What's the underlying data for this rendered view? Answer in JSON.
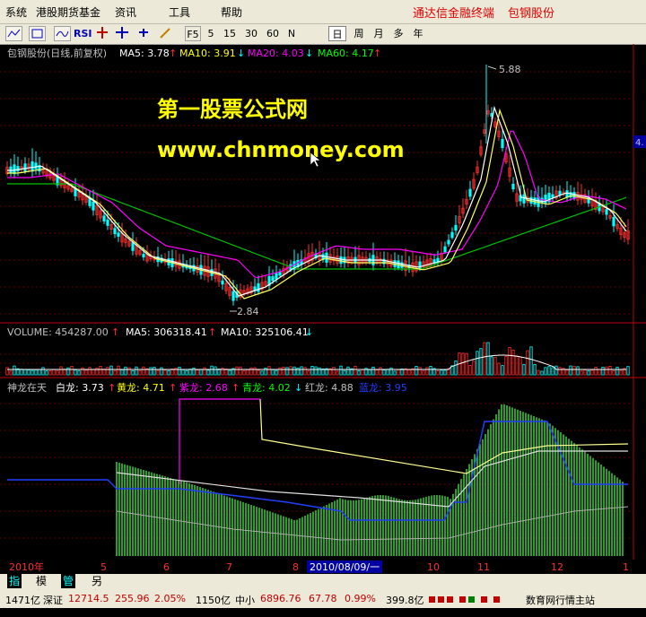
{
  "menu": {
    "items": [
      "系统",
      "港股期货基金",
      "资讯",
      "工具",
      "帮助"
    ],
    "brand": "通达信金融终端",
    "stock": "包钢股份"
  },
  "toolbar": {
    "buttons": [
      "RSI",
      "F5",
      "5",
      "15",
      "30",
      "60",
      "N",
      "日",
      "周",
      "月",
      "多",
      "年"
    ]
  },
  "price_panel": {
    "title": "包钢股份(日线,前复权)",
    "ma5": "MA5: 3.78",
    "ma10": "MA10: 3.91",
    "ma20": "MA20: 4.03",
    "ma60": "MA60: 4.17",
    "high_label": "5.88",
    "low_label": "2.84",
    "right_label": "4.",
    "watermark_cn": "第一股票公式网",
    "watermark_url": "www.chnmoney.com"
  },
  "volume_panel": {
    "vol": "VOLUME: 454287.00",
    "ma5": "MA5: 306318.41",
    "ma10": "MA10: 325106.41"
  },
  "indicator_panel": {
    "name": "神龙在天",
    "bai": "白龙: 3.73",
    "huang": "黄龙: 4.71",
    "zi": "紫龙: 2.68",
    "qing": "青龙: 4.02",
    "hong": "红龙: 4.88",
    "lan": "蓝龙: 3.95"
  },
  "time_axis": {
    "labels": [
      "2010年",
      "5",
      "6",
      "7",
      "8",
      "10",
      "11",
      "12",
      "1"
    ],
    "cursor_date": "2010/08/09/一"
  },
  "tabs": [
    "指标",
    "模板",
    "管理",
    "另存为"
  ],
  "ticker": {
    "vol1": "1471亿",
    "sz_label": "深证",
    "sz_val": "12714.5",
    "sz_chg": "255.96",
    "sz_pct": "2.05%",
    "vol2": "1150亿",
    "zx_label": "中小",
    "zx_val": "6896.76",
    "zx_chg": "67.78",
    "zx_pct": "0.99%",
    "vol3": "399.8亿",
    "right_text": "数育网行情主站"
  },
  "colors": {
    "accent": "#e00000",
    "ma5": "#ffffff",
    "ma10": "#ffff00",
    "ma20": "#ff00ff",
    "ma60": "#00ff00",
    "up": "#ff3030",
    "down": "#00ffff"
  }
}
